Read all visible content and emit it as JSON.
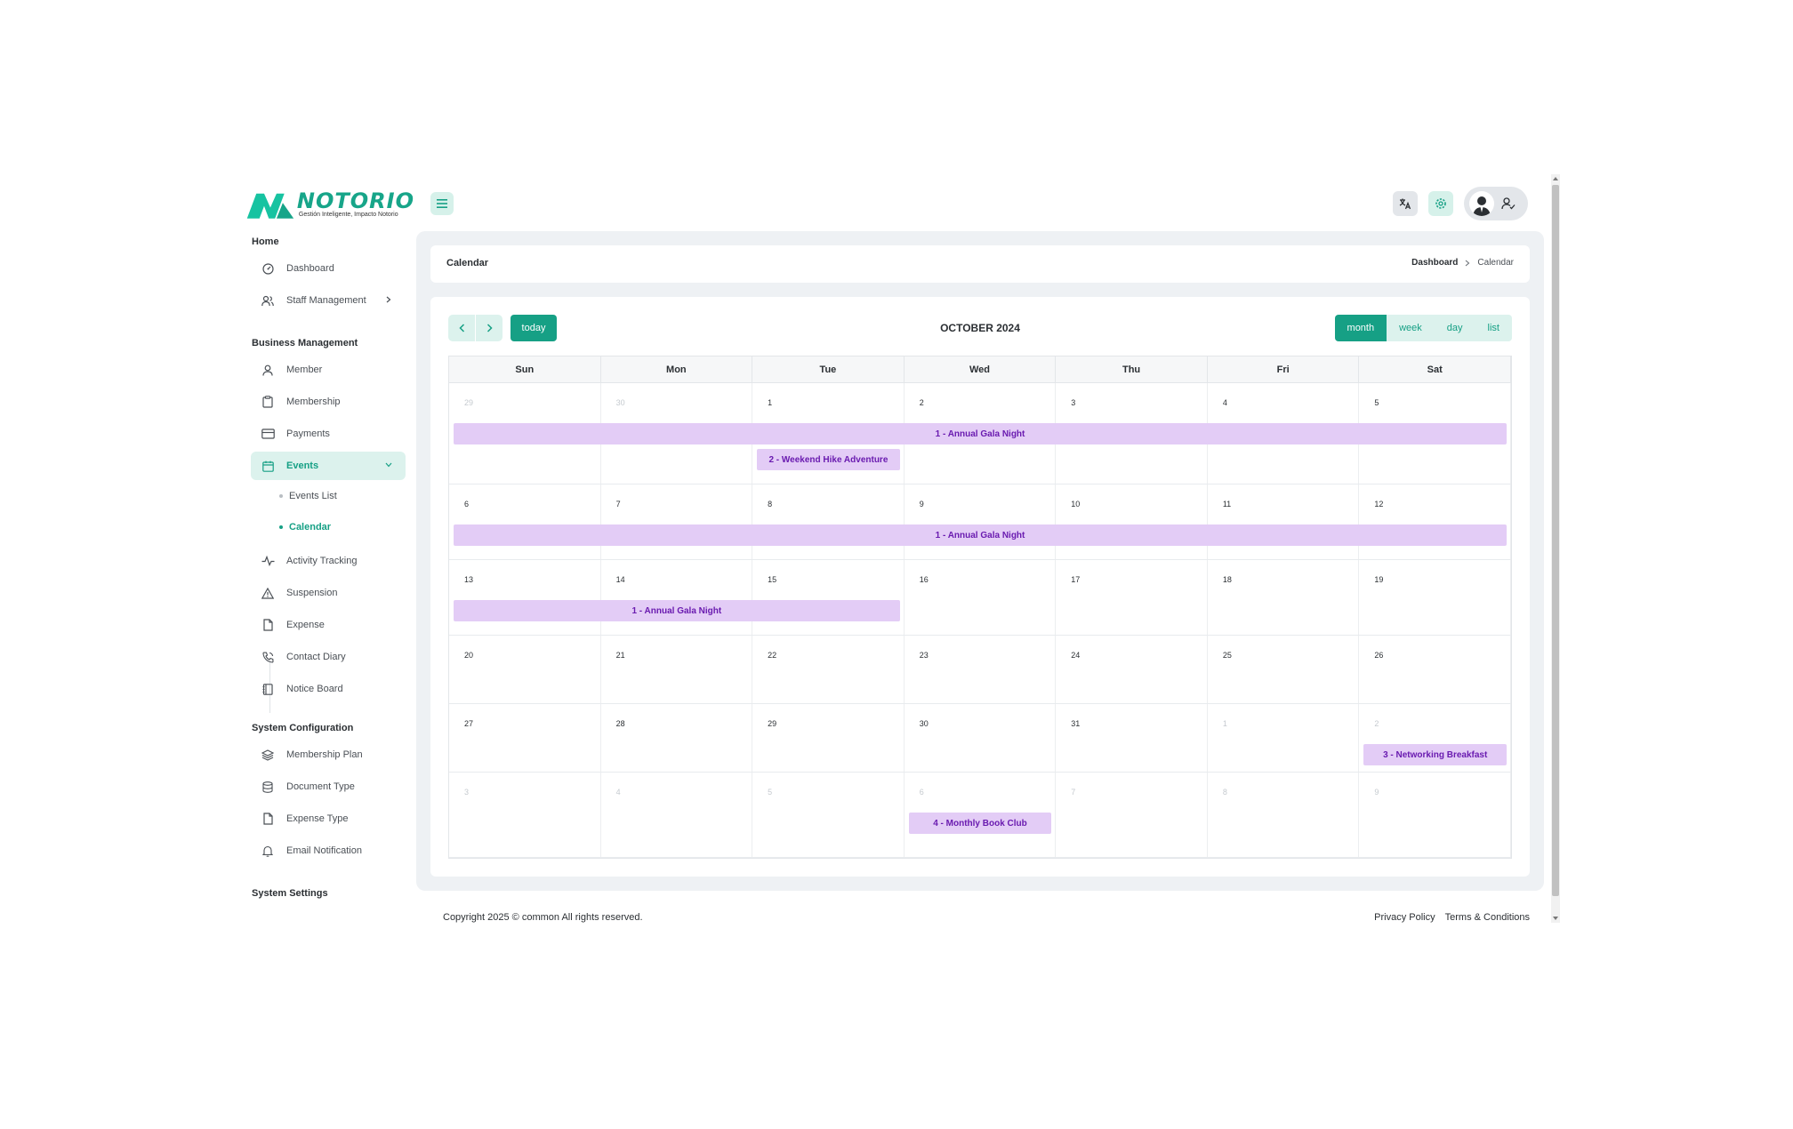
{
  "brand": {
    "name": "NOTORIO",
    "tagline": "Gestión Inteligente, Impacto Notorio",
    "accent": "#16a085"
  },
  "header": {
    "menu_icon": "hamburger-icon",
    "language_icon": "translate-icon",
    "settings_icon": "gear-icon",
    "profile_icon": "user-check-icon"
  },
  "sidebar": {
    "sections": {
      "home": "Home",
      "business": "Business Management",
      "system_config": "System Configuration",
      "system_settings": "System Settings"
    },
    "items": {
      "dashboard": "Dashboard",
      "staff": "Staff Management",
      "member": "Member",
      "membership": "Membership",
      "payments": "Payments",
      "events": "Events",
      "events_list": "Events List",
      "calendar": "Calendar",
      "activity": "Activity Tracking",
      "suspension": "Suspension",
      "expense": "Expense",
      "contact_diary": "Contact Diary",
      "notice_board": "Notice Board",
      "membership_plan": "Membership Plan",
      "document_type": "Document Type",
      "expense_type": "Expense Type",
      "email_notification": "Email Notification"
    }
  },
  "page": {
    "title": "Calendar",
    "breadcrumb": {
      "home": "Dashboard",
      "current": "Calendar"
    }
  },
  "calendar": {
    "title": "OCTOBER 2024",
    "today_label": "today",
    "views": {
      "month": "month",
      "week": "week",
      "day": "day",
      "list": "list"
    },
    "active_view": "month",
    "weekdays": [
      "Sun",
      "Mon",
      "Tue",
      "Wed",
      "Thu",
      "Fri",
      "Sat"
    ],
    "weeks": [
      {
        "days": [
          "29",
          "30",
          "1",
          "2",
          "3",
          "4",
          "5"
        ],
        "other": [
          true,
          true,
          false,
          false,
          false,
          false,
          false
        ]
      },
      {
        "days": [
          "6",
          "7",
          "8",
          "9",
          "10",
          "11",
          "12"
        ],
        "other": [
          false,
          false,
          false,
          false,
          false,
          false,
          false
        ]
      },
      {
        "days": [
          "13",
          "14",
          "15",
          "16",
          "17",
          "18",
          "19"
        ],
        "other": [
          false,
          false,
          false,
          false,
          false,
          false,
          false
        ]
      },
      {
        "days": [
          "20",
          "21",
          "22",
          "23",
          "24",
          "25",
          "26"
        ],
        "other": [
          false,
          false,
          false,
          false,
          false,
          false,
          false
        ]
      },
      {
        "days": [
          "27",
          "28",
          "29",
          "30",
          "31",
          "1",
          "2"
        ],
        "other": [
          false,
          false,
          false,
          false,
          false,
          true,
          true
        ]
      },
      {
        "days": [
          "3",
          "4",
          "5",
          "6",
          "7",
          "8",
          "9"
        ],
        "other": [
          true,
          true,
          true,
          true,
          true,
          true,
          true
        ]
      }
    ],
    "events": {
      "gala": "1 - Annual Gala Night",
      "hike": "2 - Weekend Hike Adventure",
      "breakfast": "3 - Networking Breakfast",
      "book_club": "4 - Monthly Book Club"
    },
    "event_color": "#e3ccf6",
    "event_text_color": "#6a1bb0"
  },
  "footer": {
    "copyright": "Copyright 2025 © common All rights reserved.",
    "privacy": "Privacy Policy",
    "terms": "Terms & Conditions"
  }
}
